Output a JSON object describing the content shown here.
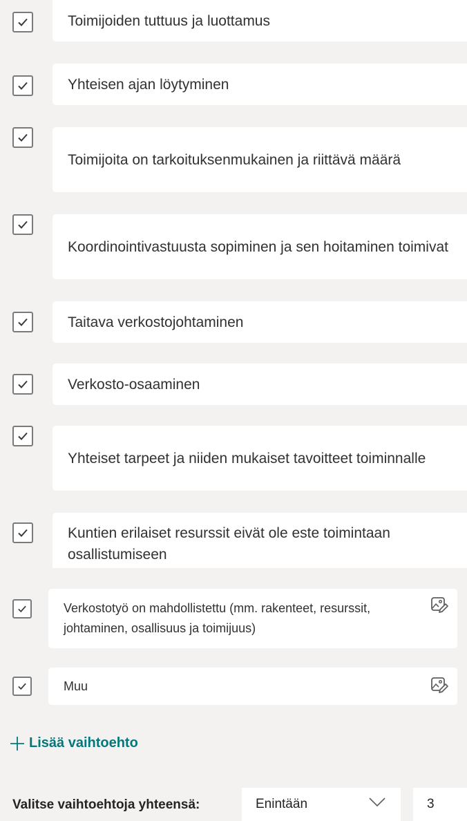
{
  "options": [
    {
      "label": "Toimijoiden tuttuus ja luottamus",
      "checked": true
    },
    {
      "label": "Yhteisen ajan löytyminen",
      "checked": true
    },
    {
      "label": "Toimijoita on tarkoituksenmukainen ja riittävä määrä",
      "checked": true
    },
    {
      "label": "Koordinointivastuusta sopiminen ja sen hoitaminen toimivat",
      "checked": true
    },
    {
      "label": "Taitava verkostojohtaminen",
      "checked": true
    },
    {
      "label": "Verkosto-osaaminen",
      "checked": true
    },
    {
      "label": "Yhteiset tarpeet ja niiden mukaiset tavoitteet toiminnalle",
      "checked": true
    },
    {
      "label": "Kuntien erilaiset resurssit eivät ole este toimintaan osallistumiseen",
      "checked": true
    }
  ],
  "options_editable": [
    {
      "label": "Verkostotyö on mahdollistettu (mm. rakenteet, resurssit, johtaminen, osallisuus ja toimijuus)",
      "checked": true,
      "icon": "image-edit-icon"
    },
    {
      "label": "Muu",
      "checked": true,
      "icon": "image-edit-icon"
    }
  ],
  "add_option": {
    "label": "Lisää vaihtoehto",
    "icon": "plus-icon"
  },
  "footer": {
    "label": "Valitse vaihtoehtoja yhteensä:",
    "mode": "Enintään",
    "count": "3"
  },
  "colors": {
    "accent": "#03787c",
    "background": "#f3f2f1",
    "card": "#ffffff",
    "checkbox_border": "#7a7a7a"
  }
}
